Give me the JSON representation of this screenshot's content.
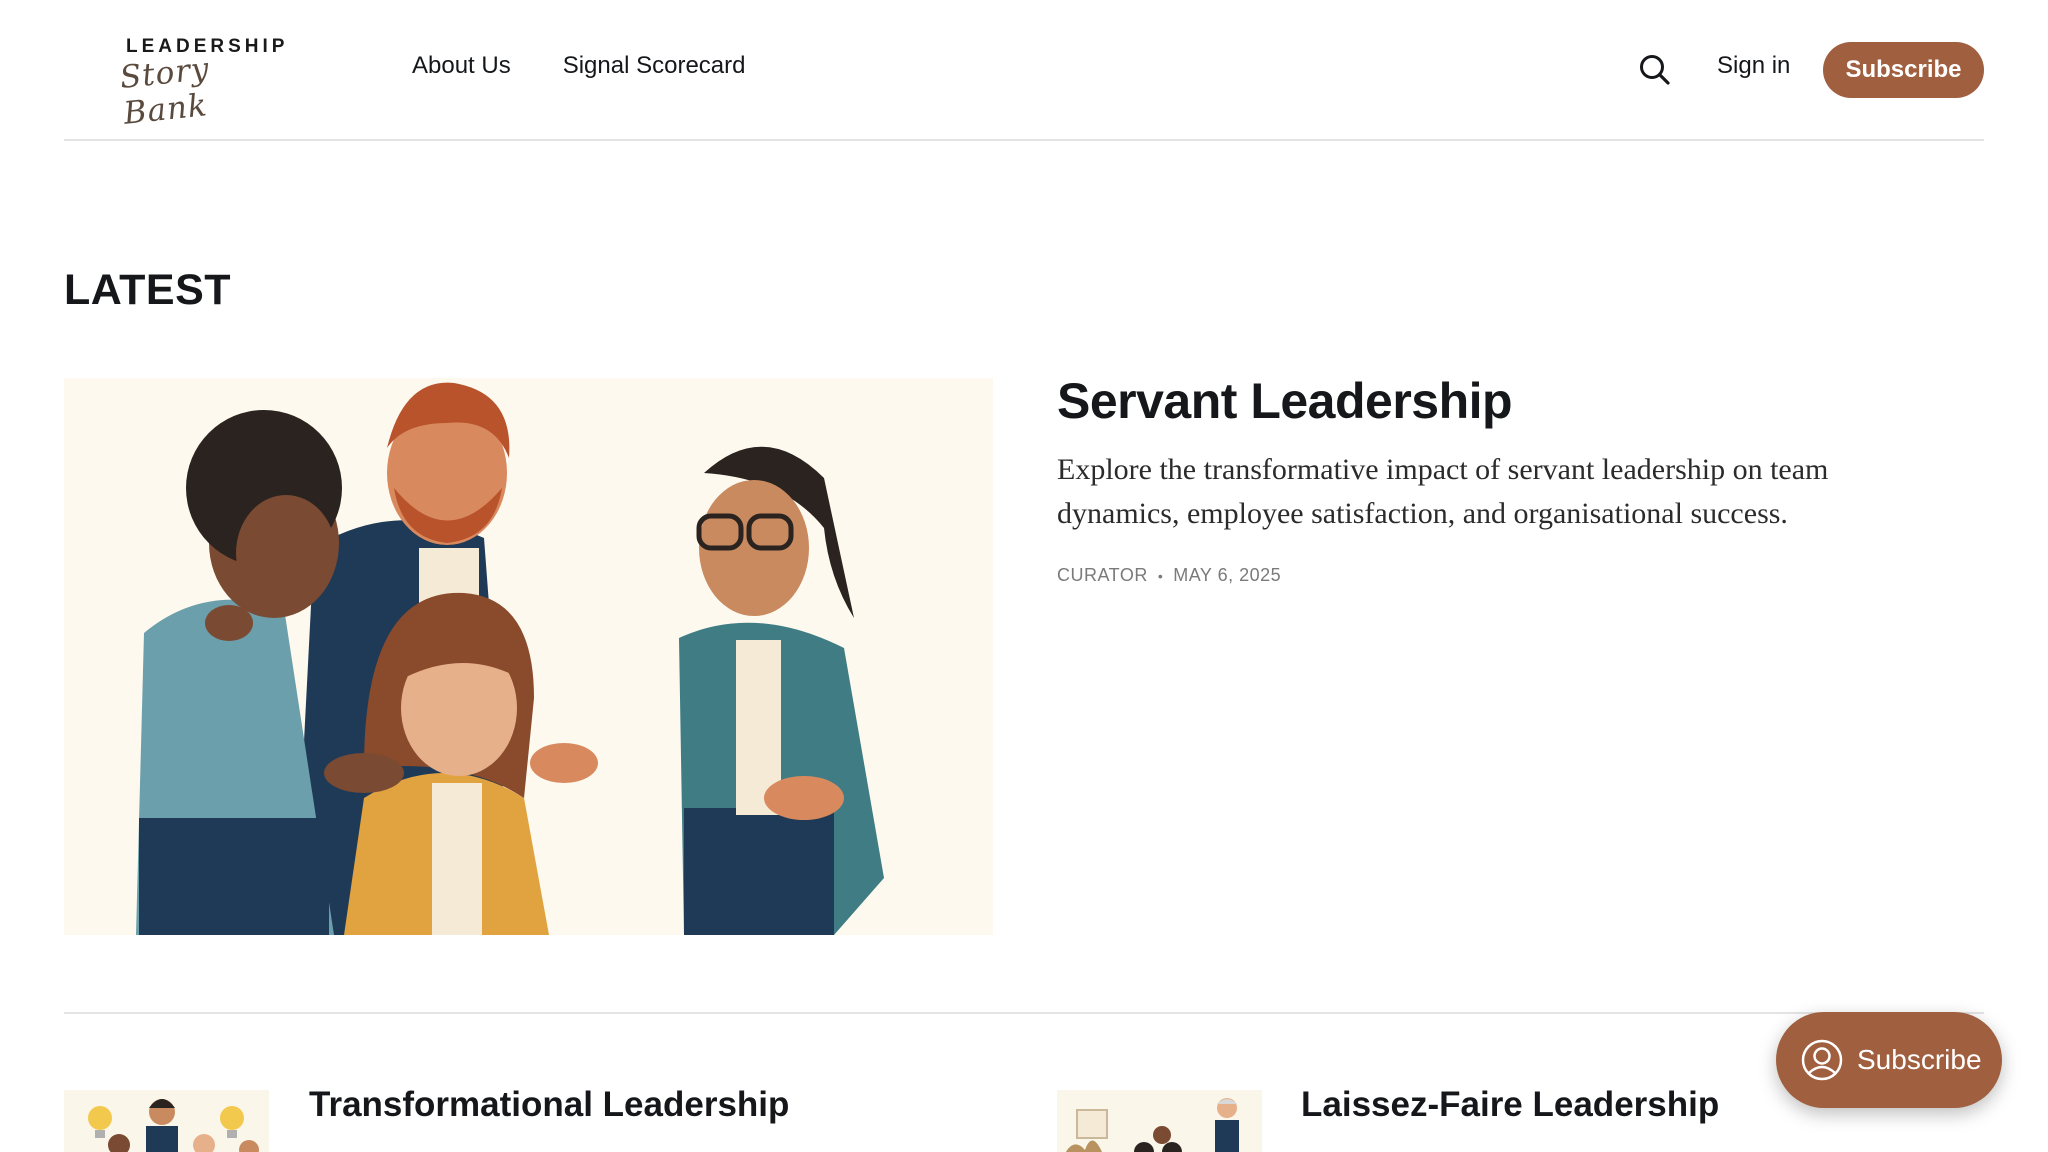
{
  "brand": {
    "top": "LEADERSHIP",
    "script": "Story Bank"
  },
  "nav": {
    "items": [
      "About Us",
      "Signal Scorecard"
    ]
  },
  "header": {
    "signin": "Sign in",
    "subscribe": "Subscribe"
  },
  "section": {
    "title": "LATEST"
  },
  "featured": {
    "title": "Servant Leadership",
    "excerpt": "Explore the transformative impact of servant leadership on team dynamics, employee satisfaction, and organisational success.",
    "author": "CURATOR",
    "date": "MAY 6, 2025"
  },
  "cards": [
    {
      "title": "Transformational Leadership"
    },
    {
      "title": "Laissez-Faire Leadership"
    }
  ],
  "portal": {
    "label": "Subscribe"
  },
  "colors": {
    "accent": "#a0603f",
    "divider": "#e4e4e4",
    "image_bg": "#fdf9ee"
  },
  "icons": {
    "search": "search-icon",
    "portal": "user-circle-icon"
  }
}
